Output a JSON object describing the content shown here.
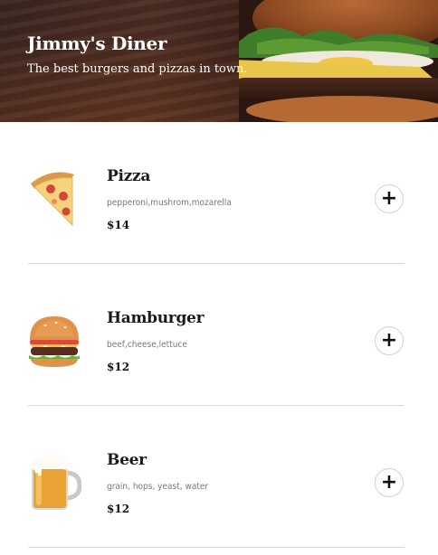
{
  "header": {
    "title": "Jimmy's Diner",
    "tagline": "The best burgers and pizzas in town."
  },
  "menu": {
    "items": [
      {
        "name": "Pizza",
        "ingredients": "pepperoni,mushrom,mozarella",
        "price": "$14",
        "icon": "pizza-slice-icon",
        "add_label": "+"
      },
      {
        "name": "Hamburger",
        "ingredients": "beef,cheese,lettuce",
        "price": "$12",
        "icon": "hamburger-icon",
        "add_label": "+"
      },
      {
        "name": "Beer",
        "ingredients": "grain, hops, yeast, water",
        "price": "$12",
        "icon": "beer-mug-icon",
        "add_label": "+"
      }
    ]
  },
  "colors": {
    "header_text": "#ffffff",
    "divider": "#d9d9d9",
    "add_button_border": "#d2d2d2"
  }
}
